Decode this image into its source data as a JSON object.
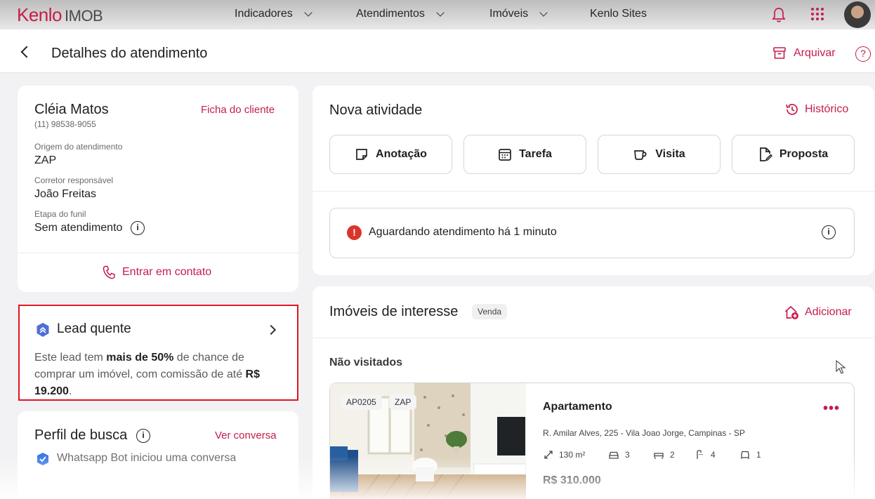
{
  "topbar": {
    "logo_brand": "Kenlo",
    "logo_product": "IMOB",
    "nav": [
      {
        "label": "Indicadores"
      },
      {
        "label": "Atendimentos"
      },
      {
        "label": "Imóveis"
      },
      {
        "label": "Kenlo Sites"
      }
    ],
    "icons": [
      "bell-icon",
      "apps-grid-icon",
      "user-avatar"
    ]
  },
  "subheader": {
    "title": "Detalhes do atendimento",
    "archive_label": "Arquivar",
    "help_label": "?"
  },
  "client": {
    "name": "Cléia Matos",
    "phone": "(11) 98538-9055",
    "ficha_label": "Ficha do cliente",
    "origem_label": "Origem do atendimento",
    "origem_value": "ZAP",
    "corretor_label": "Corretor responsável",
    "corretor_value": "João Freitas",
    "etapa_label": "Etapa do funil",
    "etapa_value": "Sem atendimento",
    "contact_label": "Entrar em contato"
  },
  "lead": {
    "title": "Lead quente",
    "text_1": "Este lead tem ",
    "text_bold_1": "mais de 50%",
    "text_2": " de chance de comprar um imóvel, com comissão de até ",
    "text_bold_2": "R$ 19.200",
    "text_3": "."
  },
  "profile": {
    "title": "Perfil de busca",
    "ver_conversa": "Ver conversa",
    "whatsapp_text": "Whatsapp Bot iniciou uma conversa"
  },
  "activity": {
    "title": "Nova atividade",
    "historico_label": "Histórico",
    "buttons": [
      {
        "label": "Anotação",
        "icon": "note-icon"
      },
      {
        "label": "Tarefa",
        "icon": "calendar-icon"
      },
      {
        "label": "Visita",
        "icon": "cup-icon"
      },
      {
        "label": "Proposta",
        "icon": "document-edit-icon"
      }
    ],
    "alert_text": "Aguardando atendimento há 1 minuto"
  },
  "imoveis": {
    "title": "Imóveis de interesse",
    "badge": "Venda",
    "adicionar_label": "Adicionar",
    "section_label": "Não visitados",
    "property": {
      "code": "AP0205",
      "source": "ZAP",
      "type": "Apartamento",
      "address": "R. Amilar Alves, 225 - Vila Joao Jorge, Campinas - SP",
      "area": "130 m²",
      "parking": "3",
      "bedrooms": "2",
      "suites": "4",
      "bathrooms": "1",
      "price": "R$ 310.000",
      "menu": "•••"
    }
  },
  "colors": {
    "brand": "#c51d4c",
    "highlight_outline": "#e0141e",
    "alert": "#d9352b",
    "badge_blue": "#3d7be8"
  }
}
